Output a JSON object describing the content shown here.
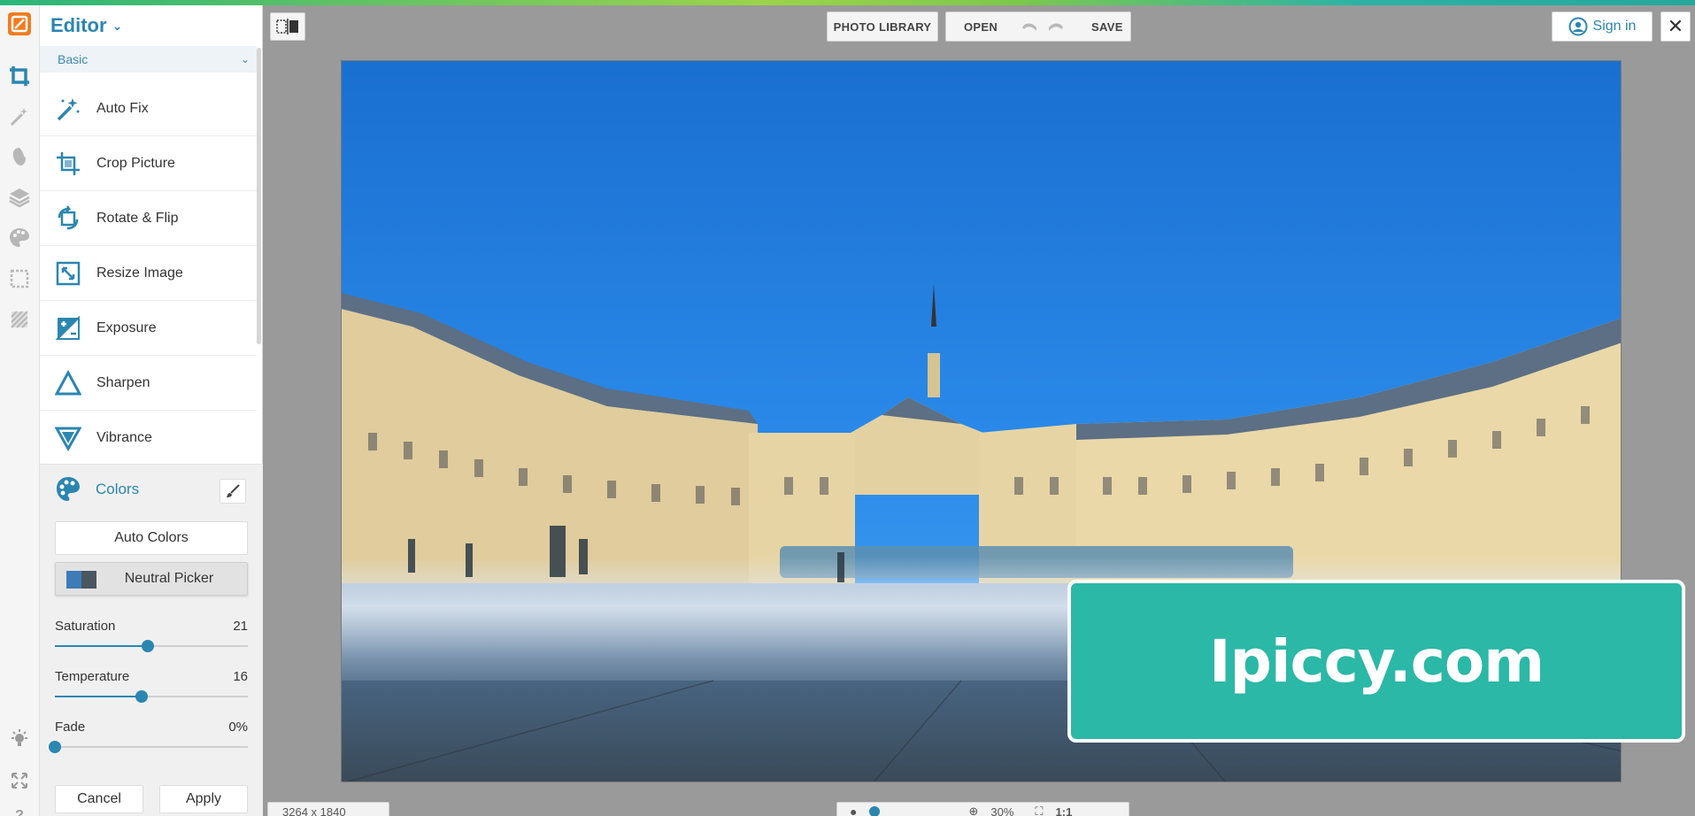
{
  "app": {
    "title": "Editor"
  },
  "sidebar": {
    "section": "Basic",
    "tools": [
      {
        "label": "Auto Fix",
        "icon": "magic-wand-icon"
      },
      {
        "label": "Crop Picture",
        "icon": "crop-icon"
      },
      {
        "label": "Rotate & Flip",
        "icon": "rotate-icon"
      },
      {
        "label": "Resize Image",
        "icon": "resize-icon"
      },
      {
        "label": "Exposure",
        "icon": "exposure-icon"
      },
      {
        "label": "Sharpen",
        "icon": "sharpen-icon"
      },
      {
        "label": "Vibrance",
        "icon": "vibrance-icon"
      }
    ]
  },
  "colors": {
    "title": "Colors",
    "auto_colors": "Auto Colors",
    "neutral_picker": "Neutral Picker",
    "sliders": [
      {
        "label": "Saturation",
        "value": "21",
        "fraction": 0.48
      },
      {
        "label": "Temperature",
        "value": "16",
        "fraction": 0.45
      },
      {
        "label": "Fade",
        "value": "0%",
        "fraction": 0.0
      }
    ],
    "cancel": "Cancel",
    "apply": "Apply"
  },
  "toolbar": {
    "photo_library": "PHOTO LIBRARY",
    "open": "OPEN",
    "save": "SAVE",
    "sign_in": "Sign in"
  },
  "watermark": "Ipiccy.com",
  "status": {
    "dimensions": "3264 x 1840",
    "zoom": "30%",
    "one_to_one": "1:1"
  },
  "colors_palette": {
    "accent": "#2b86b0",
    "orange_logo": "#f07c1f",
    "watermark_bg": "#2bb8a6"
  }
}
